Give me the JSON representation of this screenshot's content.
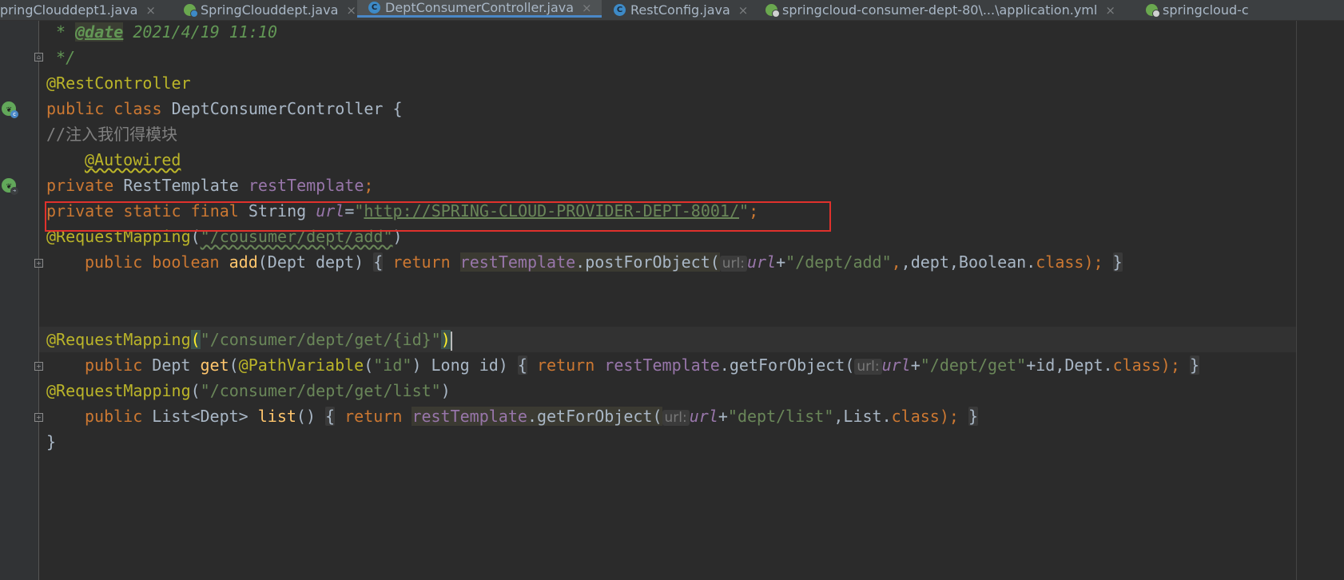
{
  "tabs": [
    {
      "label": "pringClouddept1.java",
      "icon": "none",
      "active": false
    },
    {
      "label": "SpringClouddept.java",
      "icon": "spring-boot-icon",
      "active": false
    },
    {
      "label": "DeptConsumerController.java",
      "icon": "class-icon",
      "active": true
    },
    {
      "label": "RestConfig.java",
      "icon": "class-icon",
      "active": false
    },
    {
      "label": "springcloud-consumer-dept-80\\...\\application.yml",
      "icon": "yml-icon",
      "active": false
    },
    {
      "label": "springcloud-c",
      "icon": "yml-icon",
      "active": false
    }
  ],
  "close_glyph": "×",
  "code": {
    "l1": {
      "star": " * ",
      "tag": "@date",
      "text": " 2021/4/19 11:10"
    },
    "l2": {
      "text": " */"
    },
    "l3": {
      "ann": "@RestController"
    },
    "l4": {
      "kw1": "public",
      "kw2": "class",
      "name": "DeptConsumerController",
      "brace": " {"
    },
    "l5": {
      "text": "//注入我们得模块"
    },
    "l6": {
      "ann": "@Autowired"
    },
    "l7": {
      "kw": "private",
      "type": " RestTemplate ",
      "field": "restTemplate",
      "semi": ";"
    },
    "l8": {
      "kw1": "private",
      "kw2": "static",
      "kw3": "final",
      "type": " String ",
      "field": "url",
      "eq": "=",
      "q1": "\"",
      "link": "http://SPRING-CLOUD-PROVIDER-DEPT-8001/",
      "q2": "\"",
      "semi": ";"
    },
    "l9": {
      "ann": "@RequestMapping",
      "open": "(",
      "str": "\"/cousumer/dept/add\"",
      "close": ")"
    },
    "l10": {
      "kw1": "public",
      "kw2": "boolean",
      "method": "add",
      "params": "(Dept dept) ",
      "ob": "{",
      "ret": "return",
      "field": "restTemplate",
      "call": ".postForObject(",
      "hint": "url:",
      "url": "url",
      "plus": "+",
      "str": "\"/dept/add\"",
      "rest1": ",dept,",
      "cls": "Boolean.",
      "clskw": "class",
      "end": ");",
      "cb": "}"
    },
    "l11": {
      "ann": "@RequestMapping",
      "open": "(",
      "str": "\"/consumer/dept/get/{id}\"",
      "close": ")"
    },
    "l12": {
      "kw": "public",
      "type": " Dept ",
      "method": "get",
      "open": "(",
      "ann": "@PathVariable",
      "p1": "(",
      "str": "\"id\"",
      "p2": ") Long id) ",
      "ob": "{",
      "ret": "return",
      "field": "restTemplate",
      "call": ".getForObject(",
      "hint": "url:",
      "url": "url",
      "plus": "+",
      "str2": "\"/dept/get\"",
      "rest": "+id,Dept.",
      "clskw": "class",
      "end": ");",
      "cb": "}"
    },
    "l13": {
      "ann": "@RequestMapping",
      "open": "(",
      "str": "\"/consumer/dept/get/list\"",
      "close": ")"
    },
    "l14": {
      "kw": "public",
      "type": " List<Dept> ",
      "method": "list",
      "params": "() ",
      "ob": "{",
      "ret": "return",
      "field": "restTemplate",
      "call": ".getForObject(",
      "hint": "url:",
      "url": "url",
      "plus": "+",
      "str": "\"dept/list\"",
      "rest": ",List.",
      "clskw": "class",
      "end": ");",
      "cb": "}"
    },
    "l15": {
      "text": "}"
    }
  }
}
